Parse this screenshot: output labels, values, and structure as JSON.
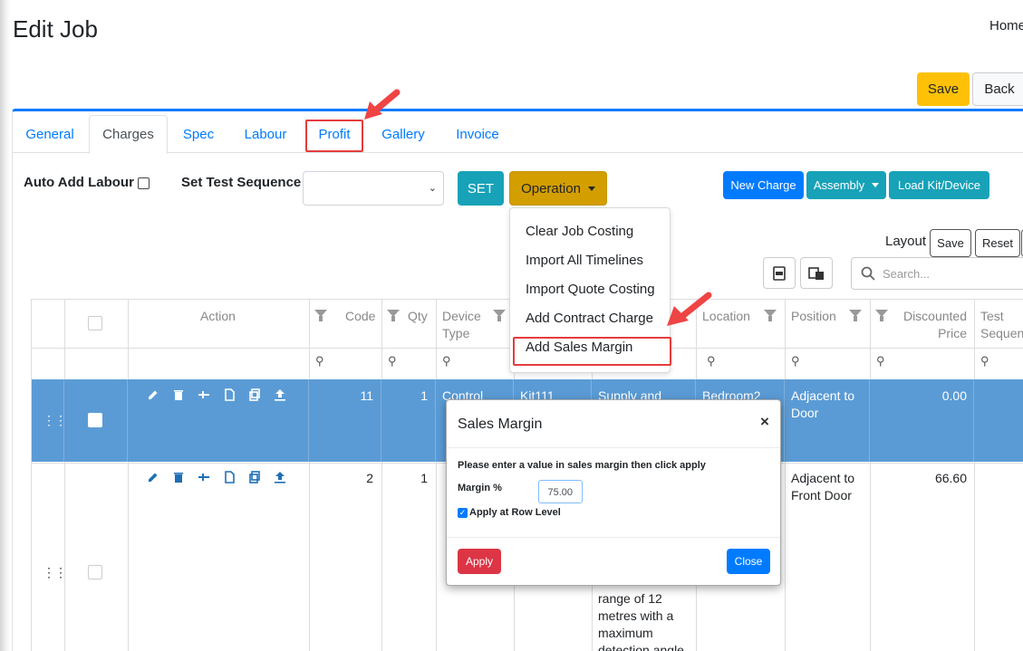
{
  "page": {
    "title": "Edit Job",
    "home": "Home"
  },
  "top_buttons": {
    "save": "Save",
    "back": "Back"
  },
  "tabs": [
    {
      "label": "General"
    },
    {
      "label": "Charges"
    },
    {
      "label": "Spec"
    },
    {
      "label": "Labour"
    },
    {
      "label": "Profit"
    },
    {
      "label": "Gallery"
    },
    {
      "label": "Invoice"
    }
  ],
  "active_tab": "Charges",
  "toolbar": {
    "auto_add_labour": "Auto Add Labour",
    "set_test_sequence": "Set Test Sequence",
    "set": "SET",
    "operation": "Operation",
    "new_charge": "New Charge",
    "assembly": "Assembly",
    "load_kit": "Load Kit/Device"
  },
  "operation_menu": [
    {
      "label": "Clear Job Costing"
    },
    {
      "label": "Import All Timelines"
    },
    {
      "label": "Import Quote Costing"
    },
    {
      "label": "Add Contract Charge"
    },
    {
      "label": "Add Sales Margin"
    }
  ],
  "layout": {
    "label": "Layout",
    "save": "Save",
    "reset": "Reset"
  },
  "search": {
    "placeholder": "Search..."
  },
  "grid": {
    "headers": {
      "action": "Action",
      "code": "Code",
      "qty": "Qty",
      "device_type_1": "Device",
      "device_type_2": "Type",
      "location": "Location",
      "position": "Position",
      "discounted_1": "Discounted",
      "discounted_2": "Price",
      "test_1": "Test",
      "test_2": "Sequence"
    },
    "rows": [
      {
        "code": "11",
        "qty": "1",
        "device_type": "Control",
        "kit": "Kit111",
        "description": "Supply and",
        "location": "Bedroom2",
        "position_1": "Adjacent to",
        "position_2": "Door",
        "price": "0.00",
        "selected": true
      },
      {
        "code": "2",
        "qty": "1",
        "description_lines": [
          "range of 12",
          "metres with a",
          "maximum",
          "detection angle"
        ],
        "position_1": "Adjacent to",
        "position_2": "Front Door",
        "price": "66.60",
        "selected": false
      }
    ]
  },
  "modal": {
    "title": "Sales Margin",
    "close_x": "×",
    "message": "Please enter a value in sales margin then click apply",
    "margin_label": "Margin %",
    "margin_value": "75.00",
    "apply_row_level": "Apply at Row Level",
    "apply_row_level_checked": true,
    "apply": "Apply",
    "close": "Close"
  },
  "colors": {
    "accent": "#007bff",
    "highlight": "#e53c3c",
    "row_selected": "#5b9bd5",
    "warning": "#ffc107",
    "info": "#17a2b8",
    "danger": "#dc3545"
  }
}
